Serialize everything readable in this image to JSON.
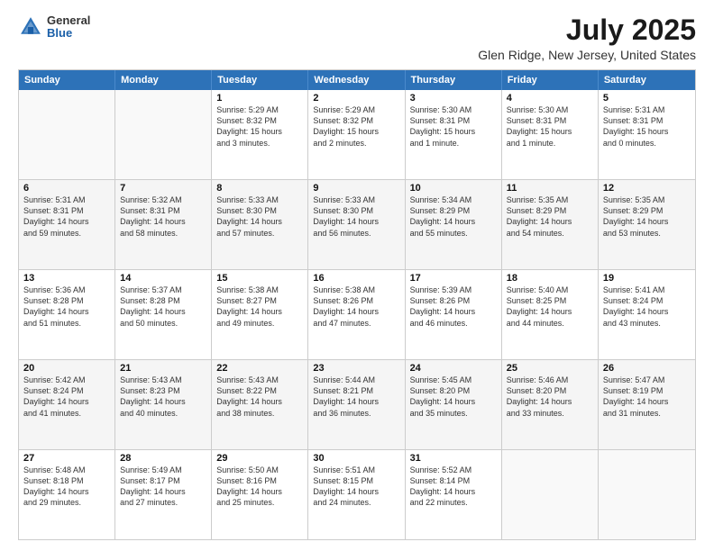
{
  "logo": {
    "general": "General",
    "blue": "Blue"
  },
  "title": "July 2025",
  "subtitle": "Glen Ridge, New Jersey, United States",
  "header_days": [
    "Sunday",
    "Monday",
    "Tuesday",
    "Wednesday",
    "Thursday",
    "Friday",
    "Saturday"
  ],
  "rows": [
    [
      {
        "day": "",
        "text": "",
        "empty": true
      },
      {
        "day": "",
        "text": "",
        "empty": true
      },
      {
        "day": "1",
        "text": "Sunrise: 5:29 AM\nSunset: 8:32 PM\nDaylight: 15 hours\nand 3 minutes."
      },
      {
        "day": "2",
        "text": "Sunrise: 5:29 AM\nSunset: 8:32 PM\nDaylight: 15 hours\nand 2 minutes."
      },
      {
        "day": "3",
        "text": "Sunrise: 5:30 AM\nSunset: 8:31 PM\nDaylight: 15 hours\nand 1 minute."
      },
      {
        "day": "4",
        "text": "Sunrise: 5:30 AM\nSunset: 8:31 PM\nDaylight: 15 hours\nand 1 minute."
      },
      {
        "day": "5",
        "text": "Sunrise: 5:31 AM\nSunset: 8:31 PM\nDaylight: 15 hours\nand 0 minutes."
      }
    ],
    [
      {
        "day": "6",
        "text": "Sunrise: 5:31 AM\nSunset: 8:31 PM\nDaylight: 14 hours\nand 59 minutes."
      },
      {
        "day": "7",
        "text": "Sunrise: 5:32 AM\nSunset: 8:31 PM\nDaylight: 14 hours\nand 58 minutes."
      },
      {
        "day": "8",
        "text": "Sunrise: 5:33 AM\nSunset: 8:30 PM\nDaylight: 14 hours\nand 57 minutes."
      },
      {
        "day": "9",
        "text": "Sunrise: 5:33 AM\nSunset: 8:30 PM\nDaylight: 14 hours\nand 56 minutes."
      },
      {
        "day": "10",
        "text": "Sunrise: 5:34 AM\nSunset: 8:29 PM\nDaylight: 14 hours\nand 55 minutes."
      },
      {
        "day": "11",
        "text": "Sunrise: 5:35 AM\nSunset: 8:29 PM\nDaylight: 14 hours\nand 54 minutes."
      },
      {
        "day": "12",
        "text": "Sunrise: 5:35 AM\nSunset: 8:29 PM\nDaylight: 14 hours\nand 53 minutes."
      }
    ],
    [
      {
        "day": "13",
        "text": "Sunrise: 5:36 AM\nSunset: 8:28 PM\nDaylight: 14 hours\nand 51 minutes."
      },
      {
        "day": "14",
        "text": "Sunrise: 5:37 AM\nSunset: 8:28 PM\nDaylight: 14 hours\nand 50 minutes."
      },
      {
        "day": "15",
        "text": "Sunrise: 5:38 AM\nSunset: 8:27 PM\nDaylight: 14 hours\nand 49 minutes."
      },
      {
        "day": "16",
        "text": "Sunrise: 5:38 AM\nSunset: 8:26 PM\nDaylight: 14 hours\nand 47 minutes."
      },
      {
        "day": "17",
        "text": "Sunrise: 5:39 AM\nSunset: 8:26 PM\nDaylight: 14 hours\nand 46 minutes."
      },
      {
        "day": "18",
        "text": "Sunrise: 5:40 AM\nSunset: 8:25 PM\nDaylight: 14 hours\nand 44 minutes."
      },
      {
        "day": "19",
        "text": "Sunrise: 5:41 AM\nSunset: 8:24 PM\nDaylight: 14 hours\nand 43 minutes."
      }
    ],
    [
      {
        "day": "20",
        "text": "Sunrise: 5:42 AM\nSunset: 8:24 PM\nDaylight: 14 hours\nand 41 minutes."
      },
      {
        "day": "21",
        "text": "Sunrise: 5:43 AM\nSunset: 8:23 PM\nDaylight: 14 hours\nand 40 minutes."
      },
      {
        "day": "22",
        "text": "Sunrise: 5:43 AM\nSunset: 8:22 PM\nDaylight: 14 hours\nand 38 minutes."
      },
      {
        "day": "23",
        "text": "Sunrise: 5:44 AM\nSunset: 8:21 PM\nDaylight: 14 hours\nand 36 minutes."
      },
      {
        "day": "24",
        "text": "Sunrise: 5:45 AM\nSunset: 8:20 PM\nDaylight: 14 hours\nand 35 minutes."
      },
      {
        "day": "25",
        "text": "Sunrise: 5:46 AM\nSunset: 8:20 PM\nDaylight: 14 hours\nand 33 minutes."
      },
      {
        "day": "26",
        "text": "Sunrise: 5:47 AM\nSunset: 8:19 PM\nDaylight: 14 hours\nand 31 minutes."
      }
    ],
    [
      {
        "day": "27",
        "text": "Sunrise: 5:48 AM\nSunset: 8:18 PM\nDaylight: 14 hours\nand 29 minutes."
      },
      {
        "day": "28",
        "text": "Sunrise: 5:49 AM\nSunset: 8:17 PM\nDaylight: 14 hours\nand 27 minutes."
      },
      {
        "day": "29",
        "text": "Sunrise: 5:50 AM\nSunset: 8:16 PM\nDaylight: 14 hours\nand 25 minutes."
      },
      {
        "day": "30",
        "text": "Sunrise: 5:51 AM\nSunset: 8:15 PM\nDaylight: 14 hours\nand 24 minutes."
      },
      {
        "day": "31",
        "text": "Sunrise: 5:52 AM\nSunset: 8:14 PM\nDaylight: 14 hours\nand 22 minutes."
      },
      {
        "day": "",
        "text": "",
        "empty": true
      },
      {
        "day": "",
        "text": "",
        "empty": true
      }
    ]
  ]
}
